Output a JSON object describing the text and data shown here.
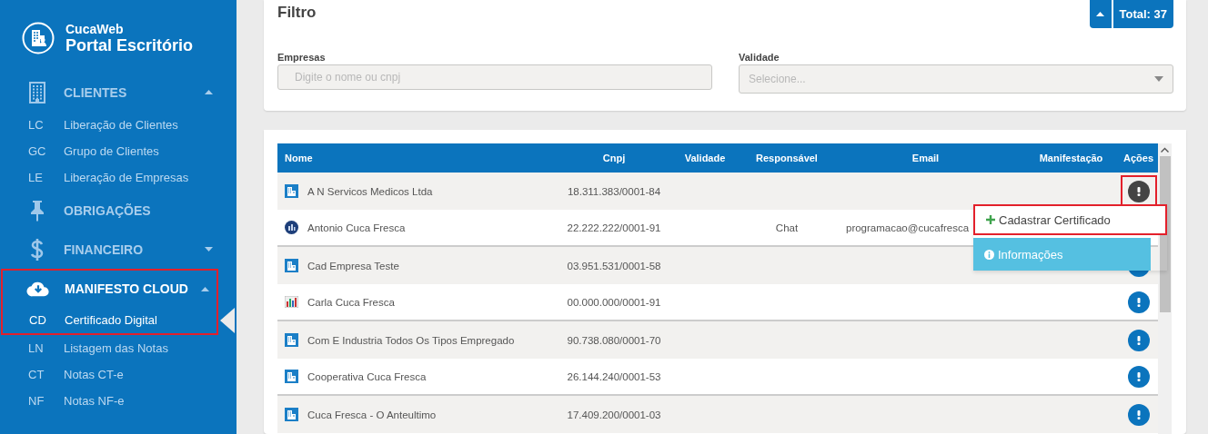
{
  "brand": {
    "name": "CucaWeb",
    "subtitle": "Portal Escritório"
  },
  "sidebar": {
    "sections": [
      {
        "label": "CLIENTES",
        "expanded": true,
        "highlighted": false,
        "children": [
          {
            "code": "LC",
            "label": "Liberação de Clientes",
            "selected": false
          },
          {
            "code": "GC",
            "label": "Grupo de Clientes",
            "selected": false
          },
          {
            "code": "LE",
            "label": "Liberação de Empresas",
            "selected": false
          }
        ]
      },
      {
        "label": "OBRIGAÇÕES",
        "highlighted": false
      },
      {
        "label": "FINANCEIRO",
        "expanded": false,
        "highlighted": false
      },
      {
        "label": "MANIFESTO CLOUD",
        "expanded": true,
        "highlighted": true,
        "children": [
          {
            "code": "CD",
            "label": "Certificado Digital",
            "selected": true
          },
          {
            "code": "LN",
            "label": "Listagem das Notas",
            "selected": false
          },
          {
            "code": "CT",
            "label": "Notas CT-e",
            "selected": false
          },
          {
            "code": "NF",
            "label": "Notas NF-e",
            "selected": false
          }
        ]
      }
    ]
  },
  "filter": {
    "title": "Filtro",
    "total": "Total: 37",
    "fields": [
      {
        "label": "Empresas",
        "kind": "text",
        "placeholder": "Digite o nome ou cnpj"
      },
      {
        "label": "Validade",
        "kind": "select",
        "placeholder": "Selecione..."
      }
    ]
  },
  "table": {
    "columns": [
      "Nome",
      "Cnpj",
      "Validade",
      "Responsável",
      "Email",
      "Manifestação",
      "Ações"
    ],
    "rows": [
      {
        "kind": "building",
        "name": "A N Servicos Medicos Ltda",
        "cnpj": "18.311.383/0001-84",
        "responsavel": "",
        "email": "",
        "action": {
          "active": true,
          "highlighted": true
        }
      },
      {
        "kind": "round",
        "name": "Antonio Cuca Fresca",
        "cnpj": "22.222.222/0001-91",
        "responsavel": "Chat",
        "email": "programacao@cucafresca"
      },
      {
        "kind": "building",
        "name": "Cad Empresa Teste",
        "cnpj": "03.951.531/0001-58",
        "responsavel": "",
        "email": "",
        "action": {
          "active": false,
          "highlighted": false
        }
      },
      {
        "kind": "thumbnail",
        "name": "Carla Cuca Fresca",
        "cnpj": "00.000.000/0001-91",
        "responsavel": "",
        "email": "",
        "action": {
          "active": false,
          "highlighted": false
        }
      },
      {
        "kind": "building",
        "name": "Com E Industria Todos Os Tipos Empregado",
        "cnpj": "90.738.080/0001-70",
        "responsavel": "",
        "email": "",
        "action": {
          "active": false,
          "highlighted": false
        }
      },
      {
        "kind": "building",
        "name": "Cooperativa Cuca Fresca",
        "cnpj": "26.144.240/0001-53",
        "responsavel": "",
        "email": "",
        "action": {
          "active": false,
          "highlighted": false
        }
      },
      {
        "kind": "building",
        "name": "Cuca Fresca - O Anteultimo",
        "cnpj": "17.409.200/0001-03",
        "responsavel": "",
        "email": "",
        "action": {
          "active": false,
          "highlighted": false
        }
      }
    ],
    "menu": [
      {
        "kind": "add",
        "label": "Cadastrar Certificado",
        "highlighted": true
      },
      {
        "kind": "info",
        "label": "Informações",
        "highlighted": false
      }
    ]
  }
}
